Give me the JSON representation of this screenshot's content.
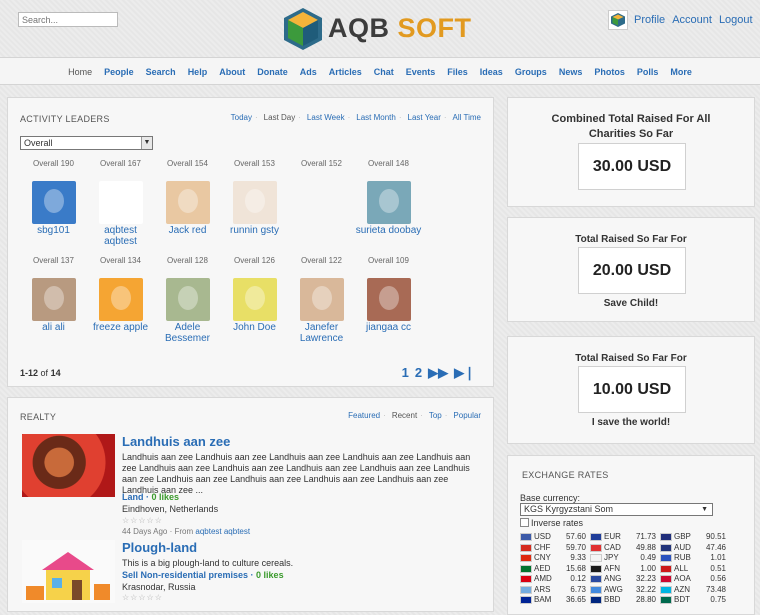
{
  "header": {
    "search_placeholder": "Search...",
    "logo_text_a": "AQB",
    "logo_text_b": "SOFT",
    "user_links": [
      "Profile",
      "Account",
      "Logout"
    ]
  },
  "nav": [
    "Home",
    "People",
    "Search",
    "Help",
    "About",
    "Donate",
    "Ads",
    "Articles",
    "Chat",
    "Events",
    "Files",
    "Ideas",
    "Groups",
    "News",
    "Photos",
    "Polls",
    "More"
  ],
  "leaders": {
    "title": "ACTIVITY LEADERS",
    "filters": [
      "Today",
      "Last Day",
      "Last Week",
      "Last Month",
      "Last Year",
      "All Time"
    ],
    "selected_filter": "Last Day",
    "select_value": "Overall",
    "members": [
      {
        "overall": "Overall 190",
        "name": "sbg101",
        "color": "#3a7bc8"
      },
      {
        "overall": "Overall 167",
        "name": "aqbtest aqbtest",
        "color": "#ffffff"
      },
      {
        "overall": "Overall 154",
        "name": "Jack red",
        "color": "#e9c8a2"
      },
      {
        "overall": "Overall 153",
        "name": "runnin gsty",
        "color": "#f0e4d8"
      },
      {
        "overall": "Overall 152",
        "name": "",
        "color": ""
      },
      {
        "overall": "Overall 148",
        "name": "surieta doobay",
        "color": "#7aa8b8"
      },
      {
        "overall": "Overall 137",
        "name": "ali ali",
        "color": "#b89a80"
      },
      {
        "overall": "Overall 134",
        "name": "freeze apple",
        "color": "#f5a533"
      },
      {
        "overall": "Overall 128",
        "name": "Adele Bessemer",
        "color": "#a8b890"
      },
      {
        "overall": "Overall 126",
        "name": "John Doe",
        "color": "#e8df66"
      },
      {
        "overall": "Overall 122",
        "name": "Janefer Lawrence",
        "color": "#d9b89a"
      },
      {
        "overall": "Overall 109",
        "name": "jiangaa cc",
        "color": "#a86a55"
      }
    ],
    "count_prefix": "1-12",
    "count_of": "of",
    "count_total": "14",
    "pages": [
      "1",
      "2"
    ]
  },
  "realty": {
    "title": "REALTY",
    "filters": [
      "Featured",
      "Recent",
      "Top",
      "Popular"
    ],
    "items": [
      {
        "title": "Landhuis aan zee",
        "desc": "Landhuis aan zee Landhuis aan zee Landhuis aan zee Landhuis aan zee Landhuis aan zee Landhuis aan zee Landhuis aan zee Landhuis aan zee Landhuis aan zee Landhuis aan zee Landhuis aan zee Landhuis aan zee Landhuis aan zee Landhuis aan zee Landhuis aan zee ...",
        "category": "Land",
        "likes": "0 likes",
        "location": "Eindhoven, Netherlands",
        "age": "44 Days Ago",
        "from_label": "From",
        "author": "aqbtest aqbtest"
      },
      {
        "title": "Plough-land",
        "desc": "This is a big plough-land to culture cereals.",
        "category": "Sell Non-residential premises",
        "likes": "0 likes",
        "location": "Krasnodar, Russia"
      }
    ]
  },
  "charity": [
    {
      "title": "Combined Total Raised For All Charities So Far",
      "amount": "30.00 USD",
      "sub": ""
    },
    {
      "title": "Total Raised So Far For",
      "amount": "20.00 USD",
      "sub": "Save Child!"
    },
    {
      "title": "Total Raised So Far For",
      "amount": "10.00 USD",
      "sub": "I save the world!"
    }
  ],
  "exchange": {
    "title": "EXCHANGE RATES",
    "base_label": "Base currency:",
    "base_value": "KGS Kyrgyzstani Som",
    "inverse_label": "Inverse rates",
    "rates": [
      {
        "code": "USD",
        "value": "57.60",
        "flag": "#3c5aa8"
      },
      {
        "code": "EUR",
        "value": "71.73",
        "flag": "#1f3d99"
      },
      {
        "code": "GBP",
        "value": "90.51",
        "flag": "#1f2d7a"
      },
      {
        "code": "CHF",
        "value": "59.70",
        "flag": "#d52b1e"
      },
      {
        "code": "CAD",
        "value": "49.88",
        "flag": "#e03030"
      },
      {
        "code": "AUD",
        "value": "47.46",
        "flag": "#22347a"
      },
      {
        "code": "CNY",
        "value": "9.33",
        "flag": "#de2910"
      },
      {
        "code": "JPY",
        "value": "0.49",
        "flag": "#f4f4f4"
      },
      {
        "code": "RUB",
        "value": "1.01",
        "flag": "#2a52be"
      },
      {
        "code": "AED",
        "value": "15.68",
        "flag": "#00732f"
      },
      {
        "code": "AFN",
        "value": "1.00",
        "flag": "#1a1a1a"
      },
      {
        "code": "ALL",
        "value": "0.51",
        "flag": "#cc1a1a"
      },
      {
        "code": "AMD",
        "value": "0.12",
        "flag": "#d90012"
      },
      {
        "code": "ANG",
        "value": "32.23",
        "flag": "#2a4aa0"
      },
      {
        "code": "AOA",
        "value": "0.56",
        "flag": "#cc092f"
      },
      {
        "code": "ARS",
        "value": "6.73",
        "flag": "#74acdf"
      },
      {
        "code": "AWG",
        "value": "32.22",
        "flag": "#4189dd"
      },
      {
        "code": "AZN",
        "value": "73.48",
        "flag": "#00b5e2"
      },
      {
        "code": "BAM",
        "value": "36.65",
        "flag": "#002395"
      },
      {
        "code": "BBD",
        "value": "28.80",
        "flag": "#00267f"
      },
      {
        "code": "BDT",
        "value": "0.75",
        "flag": "#006a4e"
      }
    ]
  }
}
